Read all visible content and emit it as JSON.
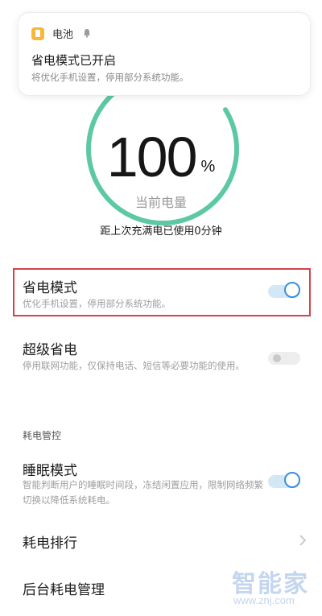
{
  "notification": {
    "app_name": "电池",
    "app_icon": "battery-app-icon",
    "bell_icon": "bell-icon",
    "title": "省电模式已开启",
    "body": "将优化手机设置，停用部分系统功能。"
  },
  "battery": {
    "level_value": "100",
    "level_unit": "%",
    "level_fraction": 1.0,
    "label": "当前电量",
    "since_full_charge": "距上次充满电已使用0分钟",
    "accent": "#5dc8a5"
  },
  "settings": {
    "power_saving": {
      "title": "省电模式",
      "description": "优化手机设置，停用部分系统功能。",
      "enabled": true
    },
    "super_power_saving": {
      "title": "超级省电",
      "description": "停用联网功能，仅保持电话、短信等必要功能的使用。",
      "enabled": false
    },
    "section_header": "耗电管控",
    "sleep_mode": {
      "title": "睡眠模式",
      "description": "智能判断用户的睡眠时间段，冻结闲置应用，限制网络频繁切换以降低系统耗电。",
      "enabled": true
    },
    "power_ranking": {
      "title": "耗电排行",
      "chevron_icon": "chevron-right-icon"
    },
    "background_power": {
      "title": "后台耗电管理"
    }
  },
  "watermark": {
    "brand": "智能家",
    "url": "www.znj.com"
  },
  "colors": {
    "toggle_on": "#3a8ee0",
    "highlight": "#d2434b"
  }
}
